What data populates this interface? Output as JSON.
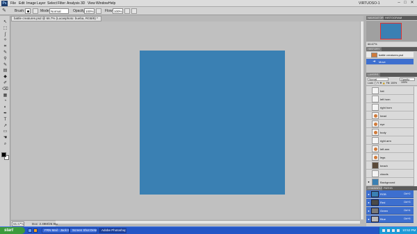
{
  "app": {
    "logo": "Ps",
    "workspace": "VIRTUOSO-1"
  },
  "menu": [
    "File",
    "Edit",
    "Image",
    "Layer",
    "Select",
    "Filter",
    "Analysis",
    "3D",
    "View",
    "Window",
    "Help"
  ],
  "window_controls": [
    "–",
    "□",
    "✕"
  ],
  "options": {
    "tool_icon": "brush-icon",
    "tool_glyph": "✎",
    "brush_label": "Brush:",
    "mode_label": "Mode:",
    "mode_value": "Normal",
    "opacity_label": "Opacity:",
    "opacity_value": "100%",
    "flow_label": "Flow:",
    "flow_value": "100%"
  },
  "tools": [
    "↖",
    "⬚",
    "ʃ",
    "✧",
    "⌗",
    "✎",
    "⚲",
    "✎",
    "▤",
    "◆",
    "✐",
    "⌫",
    "▦",
    "◔",
    "◐",
    "✒",
    "T",
    "↗",
    "▭",
    "☚",
    "⌕"
  ],
  "document": {
    "tab_title": "battle creatures.psd @ 66.7% (Lucasphoto: bueba, RGB/8) *",
    "canvas_color": "#3a80b3",
    "zoom": "66.67%",
    "doc_size": "Doc: 2.49M/26.9M"
  },
  "panels": {
    "navigator_tabs": [
      "NAVIGATOR",
      "HISTOGRAM"
    ],
    "nav_zoom": "66.67%",
    "history_tab": "HISTORY",
    "history": [
      {
        "label": "battle creatures.psd",
        "active": false,
        "icon": ""
      },
      {
        "label": "Move",
        "active": true,
        "icon": "➜"
      }
    ],
    "layers_tabs": [
      "LAYERS"
    ],
    "blend_mode": "Normal",
    "opacity": "Opacity: 100%",
    "lock": "Lock: ▢ ✎ ✥ 🔒  Fill: 100%",
    "layers": [
      {
        "name": "hat",
        "visible": false,
        "thumb": "plain",
        "selected": false
      },
      {
        "name": "left horn",
        "visible": false,
        "thumb": "plain",
        "selected": false
      },
      {
        "name": "right horn",
        "visible": false,
        "thumb": "plain",
        "selected": false
      },
      {
        "name": "head",
        "visible": false,
        "thumb": "art",
        "selected": false
      },
      {
        "name": "eye",
        "visible": false,
        "thumb": "art",
        "selected": false
      },
      {
        "name": "body",
        "visible": false,
        "thumb": "art",
        "selected": false
      },
      {
        "name": "right arm",
        "visible": false,
        "thumb": "plain",
        "selected": false
      },
      {
        "name": "left arm",
        "visible": false,
        "thumb": "art",
        "selected": false
      },
      {
        "name": "legs",
        "visible": false,
        "thumb": "art",
        "selected": false
      },
      {
        "name": "beach",
        "visible": false,
        "thumb": "dark",
        "selected": false
      },
      {
        "name": "clouds",
        "visible": false,
        "thumb": "plain",
        "selected": false
      },
      {
        "name": "Background",
        "visible": true,
        "thumb": "bg",
        "selected": false
      }
    ],
    "channels_tabs": [
      "CHANNELS",
      "PATHS"
    ],
    "channels": [
      {
        "name": "RGB",
        "key": "Ctrl+2",
        "color": "#3a80b3"
      },
      {
        "name": "Red",
        "key": "Ctrl+3",
        "color": "#4a4a4a"
      },
      {
        "name": "Green",
        "key": "Ctrl+4",
        "color": "#7a7a7a"
      },
      {
        "name": "Blue",
        "key": "Ctrl+5",
        "color": "#b8b8b8"
      }
    ]
  },
  "taskbar": {
    "start": "start",
    "tasks": [
      {
        "label": "FRN Mail - Jack B...",
        "active": false
      },
      {
        "label": "Screen Shot Deta...",
        "active": false
      },
      {
        "label": "Adobe Photoshop ...",
        "active": true
      }
    ],
    "clock": "10:52 PM"
  }
}
